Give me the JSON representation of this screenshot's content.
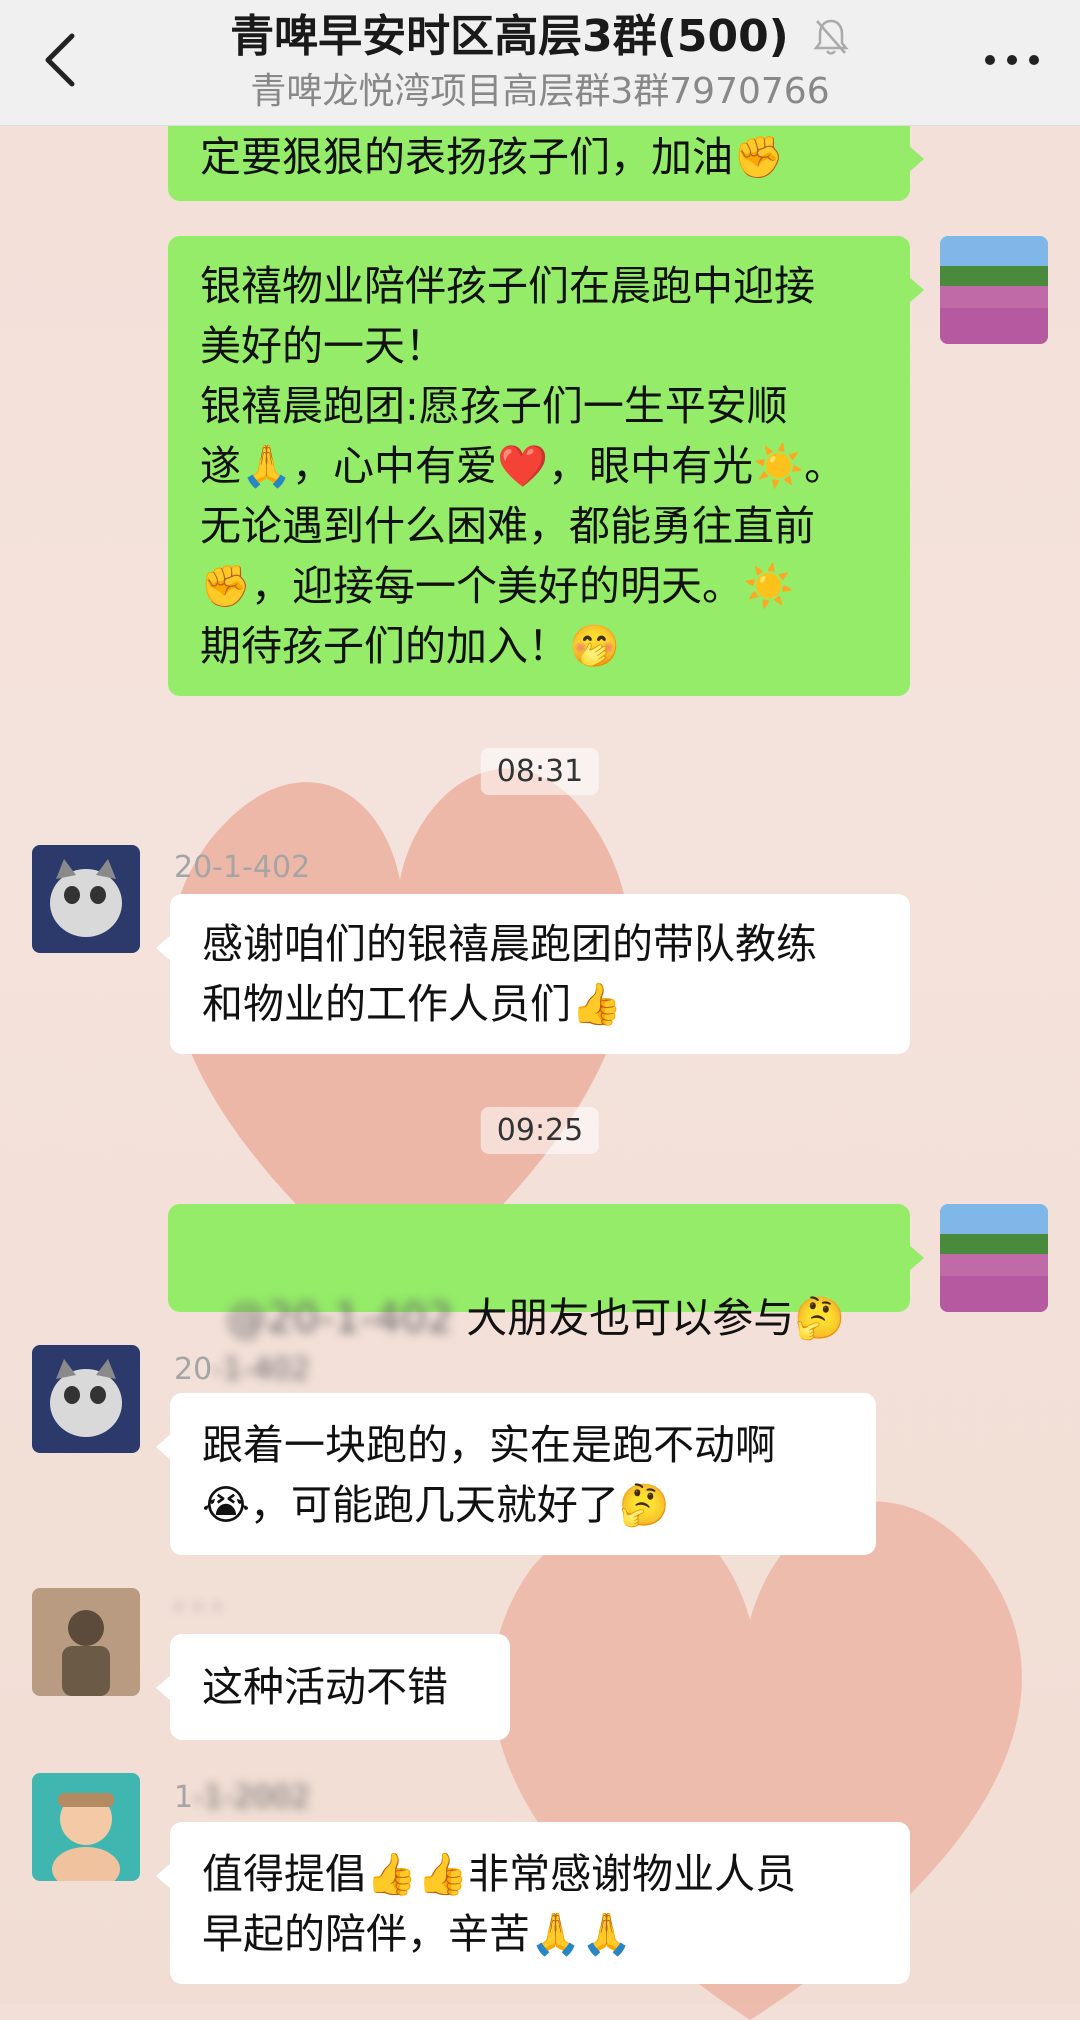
{
  "header": {
    "title": "青啤早安时区高层3群(500)",
    "subtitle": "青啤龙悦湾项目高层群3群7970766"
  },
  "messages": {
    "m1": {
      "text": "定要狠狠的表扬孩子们，加油✊"
    },
    "m2": {
      "text": "银禧物业陪伴孩子们在晨跑中迎接\n美好的一天！\n银禧晨跑团:愿孩子们一生平安顺\n遂🙏，心中有爱❤️，眼中有光☀️。\n无论遇到什么困难，都能勇往直前\n✊，迎接每一个美好的明天。☀️\n期待孩子们的加入！🤭"
    },
    "t1": "08:31",
    "m3": {
      "sender": "20-1-402",
      "text": "感谢咱们的银禧晨跑团的带队教练\n和物业的工作人员们👍"
    },
    "t2": "09:25",
    "m4": {
      "mention": "@20-1-402",
      "text": " 大朋友也可以参与🤔"
    },
    "m5": {
      "sender": "20",
      "text": "跟着一块跑的，实在是跑不动啊\n😭，可能跑几天就好了🤔"
    },
    "m6": {
      "text": "这种活动不错"
    },
    "m7": {
      "sender": "1",
      "text": "值得提倡👍👍非常感谢物业人员\n早起的陪伴，辛苦🙏🙏"
    }
  },
  "colors": {
    "green_bubble": "#95ec69",
    "white_bubble": "#ffffff",
    "header_bg": "#f0f0f0"
  }
}
